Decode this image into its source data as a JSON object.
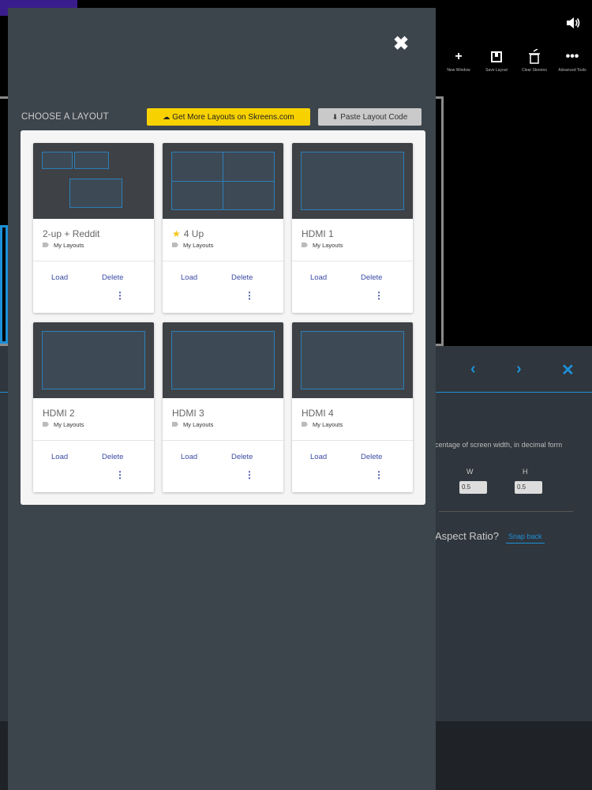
{
  "background": {
    "toolbar": [
      {
        "icon": "plus-icon",
        "label": "New Window"
      },
      {
        "icon": "save-layout-icon",
        "label": "Save Layout"
      },
      {
        "icon": "trash-icon",
        "label": "Clear Skreens"
      },
      {
        "icon": "more-icon",
        "label": "Advanced Tools"
      }
    ],
    "panel": {
      "description": "centage of screen width, in decimal form",
      "w_label": "W",
      "h_label": "H",
      "w_value": "0.5",
      "h_value": "0.5",
      "aspect_label": "Aspect Ratio?",
      "snap_label": "Snap back"
    },
    "accent_color": "#1e90d8"
  },
  "modal": {
    "title": "CHOOSE A LAYOUT",
    "more_layouts_label": "Get More Layouts on Skreens.com",
    "paste_label": "Paste Layout Code",
    "more_color": "#f8d200",
    "layouts": [
      {
        "name": "2-up + Reddit",
        "tag": "My Layouts",
        "favorite": false,
        "load": "Load",
        "delete": "Delete"
      },
      {
        "name": "4 Up",
        "tag": "My Layouts",
        "favorite": true,
        "load": "Load",
        "delete": "Delete"
      },
      {
        "name": "HDMI 1",
        "tag": "My Layouts",
        "favorite": false,
        "load": "Load",
        "delete": "Delete"
      },
      {
        "name": "HDMI 2",
        "tag": "My Layouts",
        "favorite": false,
        "load": "Load",
        "delete": "Delete"
      },
      {
        "name": "HDMI 3",
        "tag": "My Layouts",
        "favorite": false,
        "load": "Load",
        "delete": "Delete"
      },
      {
        "name": "HDMI 4",
        "tag": "My Layouts",
        "favorite": false,
        "load": "Load",
        "delete": "Delete"
      }
    ]
  }
}
